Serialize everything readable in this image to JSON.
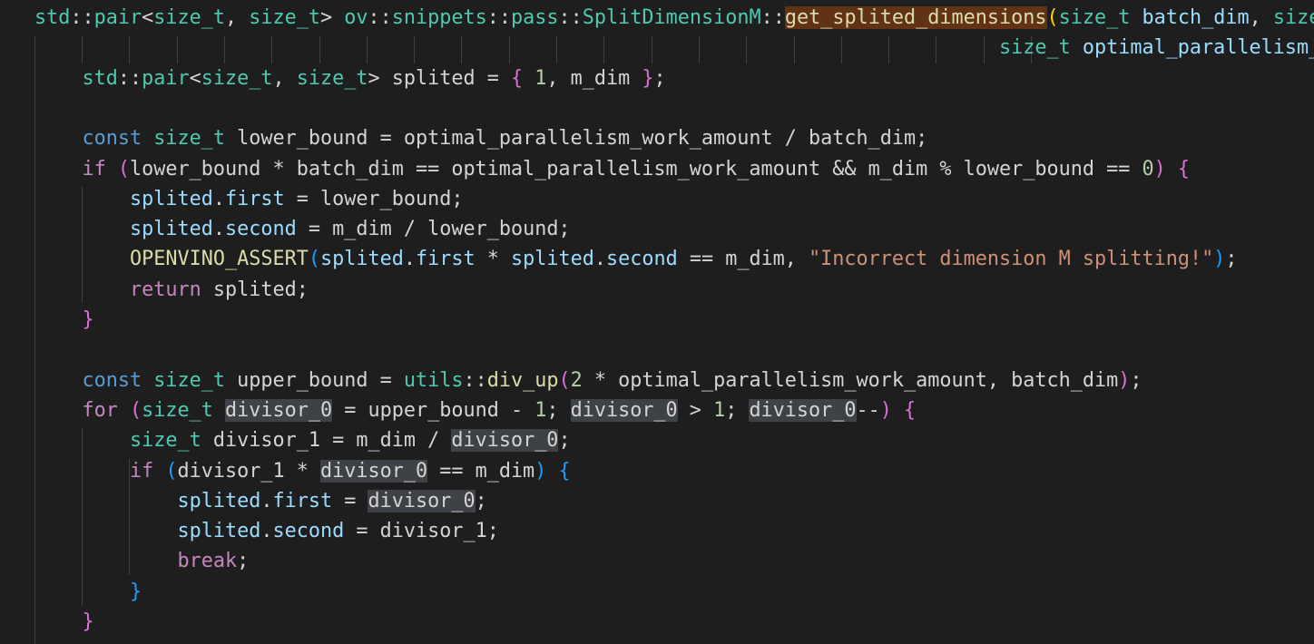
{
  "editor": {
    "theme": "dark",
    "colors": {
      "background": "#1e1e1e",
      "default_text": "#d4d4d4",
      "type": "#4ec9b0",
      "keyword": "#569cd6",
      "control": "#c586c0",
      "function": "#dcdcaa",
      "variable": "#9cdcfe",
      "number": "#b5cea8",
      "string": "#ce9178",
      "bracket_level_1": "#ffd700",
      "bracket_level_2": "#da70d6",
      "bracket_level_3": "#179fff",
      "highlight_function": "#613214",
      "highlight_symbol": "#3e4145",
      "indent_guide": "#404040"
    },
    "lines": [
      [
        [
          "std",
          "ty"
        ],
        [
          "::",
          "cd"
        ],
        [
          "pair",
          "ty"
        ],
        [
          "<",
          "cd"
        ],
        [
          "size_t",
          "ty"
        ],
        [
          ", ",
          "cd"
        ],
        [
          "size_t",
          "ty"
        ],
        [
          "> ",
          "cd"
        ],
        [
          "ov",
          "ty"
        ],
        [
          "::",
          "cd"
        ],
        [
          "snippets",
          "ty"
        ],
        [
          "::",
          "cd"
        ],
        [
          "pass",
          "ty"
        ],
        [
          "::",
          "cd"
        ],
        [
          "SplitDimensionM",
          "ty"
        ],
        [
          "::",
          "cd"
        ],
        [
          "get_splited_dimensions",
          "fn hl-fn"
        ],
        [
          "(",
          "br1"
        ],
        [
          "size_t",
          "ty"
        ],
        [
          " ",
          "cd"
        ],
        [
          "batch_dim",
          "var"
        ],
        [
          ", ",
          "cd"
        ],
        [
          "size_t",
          "ty"
        ]
      ],
      [
        [
          "                                                                                 ",
          "cd"
        ],
        [
          "size_t",
          "ty"
        ],
        [
          " ",
          "cd"
        ],
        [
          "optimal_parallelism_work_amount",
          "var"
        ]
      ],
      [
        [
          "    ",
          "cd"
        ],
        [
          "std",
          "ty"
        ],
        [
          "::",
          "cd"
        ],
        [
          "pair",
          "ty"
        ],
        [
          "<",
          "cd"
        ],
        [
          "size_t",
          "ty"
        ],
        [
          ", ",
          "cd"
        ],
        [
          "size_t",
          "ty"
        ],
        [
          "> splited = ",
          "cd"
        ],
        [
          "{",
          "br2"
        ],
        [
          " ",
          "cd"
        ],
        [
          "1",
          "num"
        ],
        [
          ", m_dim ",
          "cd"
        ],
        [
          "}",
          "br2"
        ],
        [
          ";",
          "cd"
        ]
      ],
      [],
      [
        [
          "    ",
          "cd"
        ],
        [
          "const",
          "kw"
        ],
        [
          " ",
          "cd"
        ],
        [
          "size_t",
          "ty"
        ],
        [
          " lower_bound = optimal_parallelism_work_amount / batch_dim;",
          "cd"
        ]
      ],
      [
        [
          "    ",
          "cd"
        ],
        [
          "if",
          "ctl"
        ],
        [
          " ",
          "cd"
        ],
        [
          "(",
          "br2"
        ],
        [
          "lower_bound * batch_dim == optimal_parallelism_work_amount && m_dim % lower_bound == ",
          "cd"
        ],
        [
          "0",
          "num"
        ],
        [
          ")",
          "br2"
        ],
        [
          " ",
          "cd"
        ],
        [
          "{",
          "br2"
        ]
      ],
      [
        [
          "        ",
          "cd"
        ],
        [
          "splited",
          "var"
        ],
        [
          ".",
          "cd"
        ],
        [
          "first",
          "var"
        ],
        [
          " = lower_bound;",
          "cd"
        ]
      ],
      [
        [
          "        ",
          "cd"
        ],
        [
          "splited",
          "var"
        ],
        [
          ".",
          "cd"
        ],
        [
          "second",
          "var"
        ],
        [
          " = m_dim / lower_bound;",
          "cd"
        ]
      ],
      [
        [
          "        ",
          "cd"
        ],
        [
          "OPENVINO_ASSERT",
          "mac"
        ],
        [
          "(",
          "br3"
        ],
        [
          "splited",
          "var"
        ],
        [
          ".",
          "cd"
        ],
        [
          "first",
          "var"
        ],
        [
          " * ",
          "cd"
        ],
        [
          "splited",
          "var"
        ],
        [
          ".",
          "cd"
        ],
        [
          "second",
          "var"
        ],
        [
          " == m_dim, ",
          "cd"
        ],
        [
          "\"Incorrect dimension M splitting!\"",
          "str"
        ],
        [
          ")",
          "br3"
        ],
        [
          ";",
          "cd"
        ]
      ],
      [
        [
          "        ",
          "cd"
        ],
        [
          "return",
          "ctl"
        ],
        [
          " splited;",
          "cd"
        ]
      ],
      [
        [
          "    ",
          "cd"
        ],
        [
          "}",
          "br2"
        ]
      ],
      [],
      [
        [
          "    ",
          "cd"
        ],
        [
          "const",
          "kw"
        ],
        [
          " ",
          "cd"
        ],
        [
          "size_t",
          "ty"
        ],
        [
          " upper_bound = ",
          "cd"
        ],
        [
          "utils",
          "ty"
        ],
        [
          "::",
          "cd"
        ],
        [
          "div_up",
          "fn"
        ],
        [
          "(",
          "br2"
        ],
        [
          "2",
          "num"
        ],
        [
          " * optimal_parallelism_work_amount, batch_dim",
          "cd"
        ],
        [
          ")",
          "br2"
        ],
        [
          ";",
          "cd"
        ]
      ],
      [
        [
          "    ",
          "cd"
        ],
        [
          "for",
          "ctl"
        ],
        [
          " ",
          "cd"
        ],
        [
          "(",
          "br2"
        ],
        [
          "size_t",
          "ty"
        ],
        [
          " ",
          "cd"
        ],
        [
          "divisor_0",
          "cd hl-sym"
        ],
        [
          " = upper_bound - ",
          "cd"
        ],
        [
          "1",
          "num"
        ],
        [
          "; ",
          "cd"
        ],
        [
          "divisor_0",
          "cd hl-sym"
        ],
        [
          " > ",
          "cd"
        ],
        [
          "1",
          "num"
        ],
        [
          "; ",
          "cd"
        ],
        [
          "divisor_0",
          "cd hl-sym"
        ],
        [
          "--",
          "cd"
        ],
        [
          ")",
          "br2"
        ],
        [
          " ",
          "cd"
        ],
        [
          "{",
          "br2"
        ]
      ],
      [
        [
          "        ",
          "cd"
        ],
        [
          "size_t",
          "ty"
        ],
        [
          " divisor_1 = m_dim / ",
          "cd"
        ],
        [
          "divisor_0",
          "cd hl-sym"
        ],
        [
          ";",
          "cd"
        ]
      ],
      [
        [
          "        ",
          "cd"
        ],
        [
          "if",
          "ctl"
        ],
        [
          " ",
          "cd"
        ],
        [
          "(",
          "br3"
        ],
        [
          "divisor_1 * ",
          "cd"
        ],
        [
          "divisor_0",
          "cd hl-sym"
        ],
        [
          " == m_dim",
          "cd"
        ],
        [
          ")",
          "br3"
        ],
        [
          " ",
          "cd"
        ],
        [
          "{",
          "br3"
        ]
      ],
      [
        [
          "            ",
          "cd"
        ],
        [
          "splited",
          "var"
        ],
        [
          ".",
          "cd"
        ],
        [
          "first",
          "var"
        ],
        [
          " = ",
          "cd"
        ],
        [
          "divisor_0",
          "cd hl-sym"
        ],
        [
          ";",
          "cd"
        ]
      ],
      [
        [
          "            ",
          "cd"
        ],
        [
          "splited",
          "var"
        ],
        [
          ".",
          "cd"
        ],
        [
          "second",
          "var"
        ],
        [
          " = divisor_1;",
          "cd"
        ]
      ],
      [
        [
          "            ",
          "cd"
        ],
        [
          "break",
          "ctl"
        ],
        [
          ";",
          "cd"
        ]
      ],
      [
        [
          "        ",
          "cd"
        ],
        [
          "}",
          "br3"
        ]
      ],
      [
        [
          "    ",
          "cd"
        ],
        [
          "}",
          "br2"
        ]
      ]
    ]
  }
}
